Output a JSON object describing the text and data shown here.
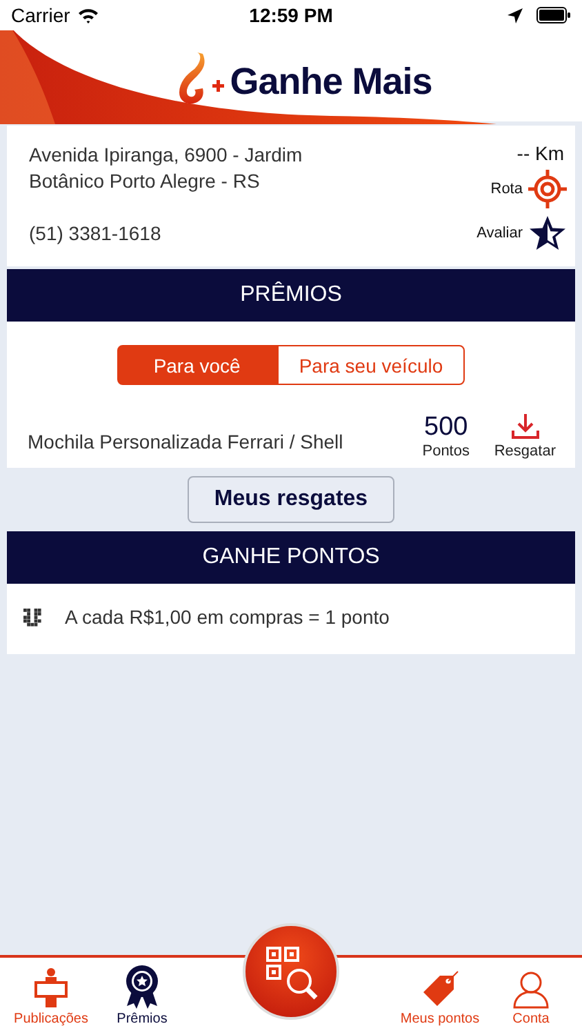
{
  "status_bar": {
    "carrier": "Carrier",
    "time": "12:59 PM"
  },
  "header": {
    "logo_text": "Ganhe Mais"
  },
  "store": {
    "address": "Avenida Ipiranga, 6900  - Jardim Botânico Porto Alegre - RS",
    "phone": "(51) 3381-1618",
    "distance": "-- Km",
    "actions": [
      {
        "kind": "route",
        "label": "Rota"
      },
      {
        "kind": "rate",
        "label": "Avaliar"
      }
    ]
  },
  "premios": {
    "title": "PRÊMIOS",
    "segments": [
      {
        "label": "Para você",
        "selected": true
      },
      {
        "label": "Para seu veículo",
        "selected": false
      }
    ],
    "rewards": [
      {
        "name": "Mochila Personalizada Ferrari / Shell",
        "points": "500",
        "points_label": "Pontos",
        "action": "Resgatar"
      }
    ],
    "button": "Meus resgates"
  },
  "ganhe_pontos": {
    "title": "GANHE PONTOS",
    "rules": [
      {
        "text": "A cada R$1,00 em compras = 1 ponto"
      }
    ]
  },
  "tab_bar": {
    "items": [
      {
        "kind": "publications",
        "label": "Publicações",
        "selected": false
      },
      {
        "kind": "awards",
        "label": "Prêmios",
        "selected": true
      },
      {
        "kind": "scan"
      },
      {
        "kind": "points",
        "label": "Meus pontos",
        "selected": false
      },
      {
        "kind": "account",
        "label": "Conta",
        "selected": false
      }
    ]
  }
}
